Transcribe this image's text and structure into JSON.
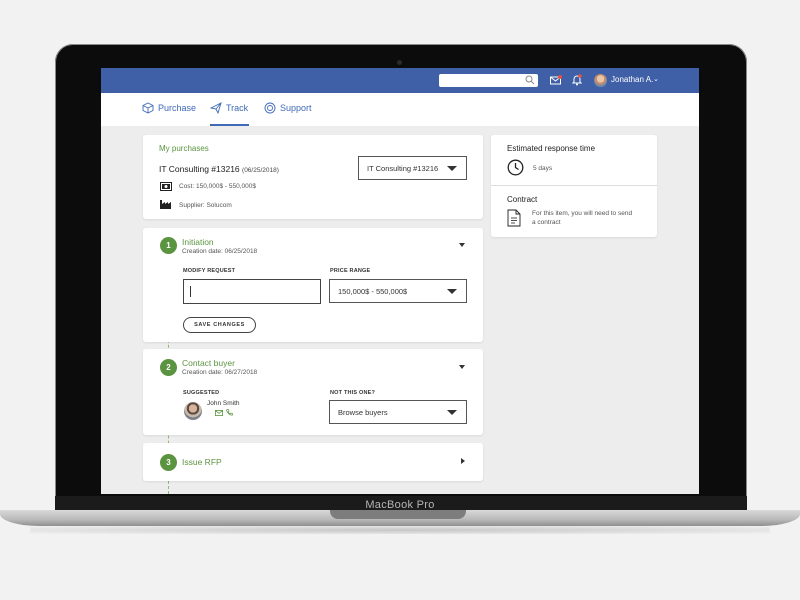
{
  "device": {
    "brand": "MacBook Pro"
  },
  "topbar": {
    "user_name": "Jonathan A.",
    "icons": [
      "search-icon",
      "mail-icon",
      "bell-icon",
      "chevron-down-icon"
    ]
  },
  "tabs": [
    {
      "label": "Purchase",
      "icon": "box-icon"
    },
    {
      "label": "Track",
      "icon": "paper-plane-icon",
      "active": true
    },
    {
      "label": "Support",
      "icon": "lifebuoy-icon"
    }
  ],
  "purchases": {
    "heading": "My purchases",
    "item_title": "IT Consulting #13216",
    "item_date": "(06/25/2018)",
    "cost": "Cost: 150,000$ - 550,000$",
    "supplier": "Supplier: Solucom",
    "select_value": "IT Consulting #13216"
  },
  "steps": [
    {
      "number": "1",
      "title": "Initiation",
      "creation_date": "Creation date: 06/25/2018",
      "modify_label": "MODIFY REQUEST",
      "modify_value": "",
      "price_label": "PRICE RANGE",
      "price_value": "150,000$ - 550,000$",
      "save_label": "SAVE CHANGES"
    },
    {
      "number": "2",
      "title": "Contact buyer",
      "creation_date": "Creation date: 06/27/2018",
      "suggested_label": "SUGGESTED",
      "suggested_name": "John Smith",
      "not_this_label": "NOT THIS ONE?",
      "browse_value": "Browse buyers"
    },
    {
      "number": "3",
      "title": "Issue RFP"
    }
  ],
  "side": {
    "response_title": "Estimated response time",
    "response_value": "5 days",
    "contract_title": "Contract",
    "contract_text_1": "For this item, you will need to send",
    "contract_text_2": "a contract"
  },
  "colors": {
    "brand_blue": "#3f5fa6",
    "accent_green": "#5b9441",
    "tab_blue": "#3f6ab8"
  }
}
